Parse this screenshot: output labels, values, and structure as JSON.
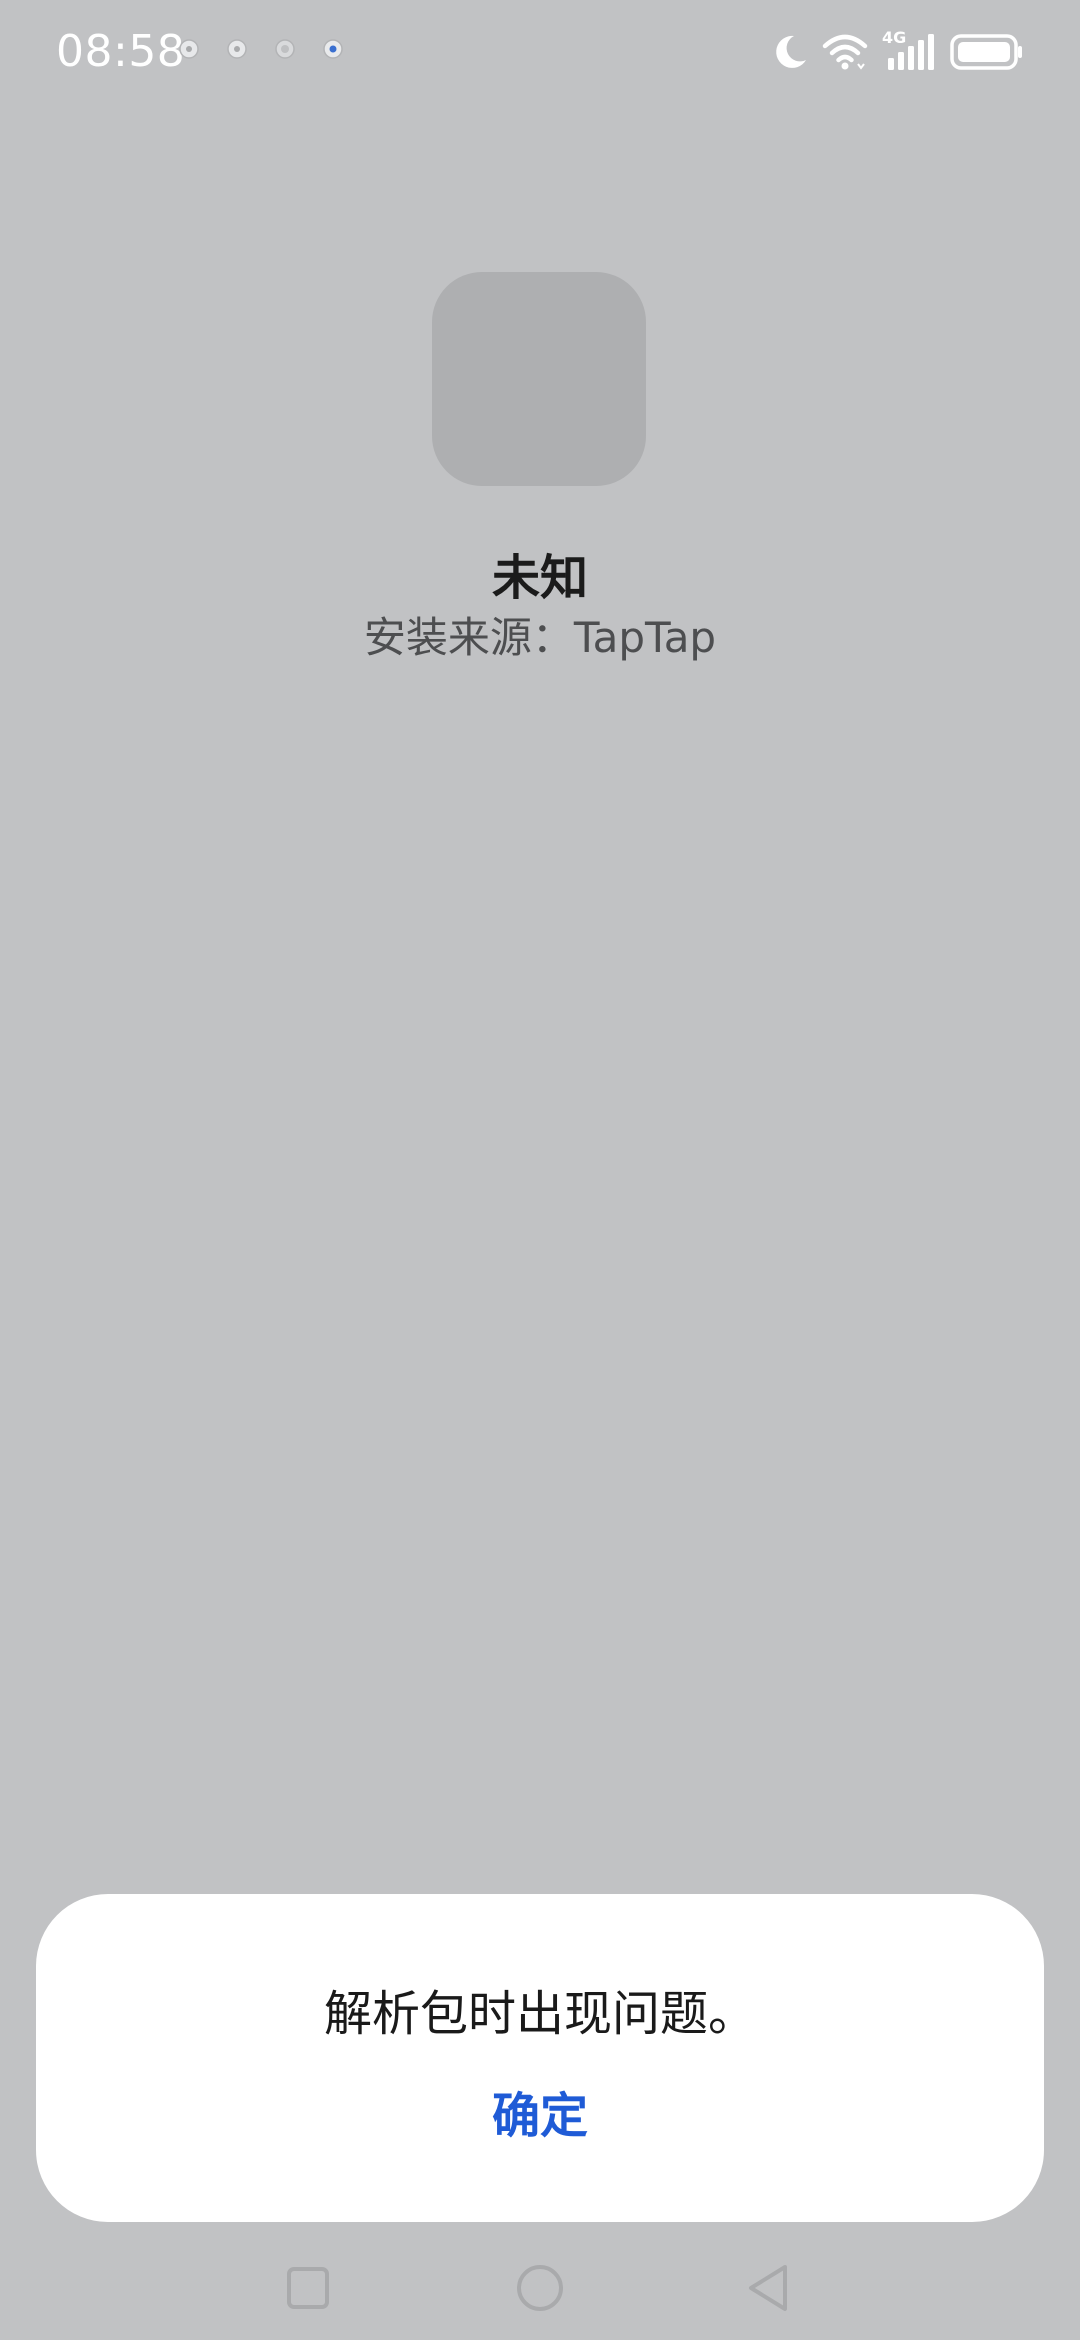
{
  "status_bar": {
    "time": "08:58",
    "notification_icons": [
      "app-notification-icon",
      "app-notification-icon",
      "app-notification-icon",
      "app-notification-icon"
    ],
    "right_icons": [
      "moon-icon",
      "wifi-icon",
      "4g-signal-icon",
      "battery-icon"
    ],
    "network_label": "4G"
  },
  "app": {
    "icon": "app-placeholder-icon",
    "name": "未知",
    "install_source": "安装来源：TapTap"
  },
  "dialog": {
    "message": "解析包时出现问题。",
    "confirm_label": "确定",
    "accent_color": "#1f5bd6"
  },
  "nav_bar": {
    "buttons": [
      "recents-square-icon",
      "home-circle-icon",
      "back-triangle-icon"
    ]
  }
}
